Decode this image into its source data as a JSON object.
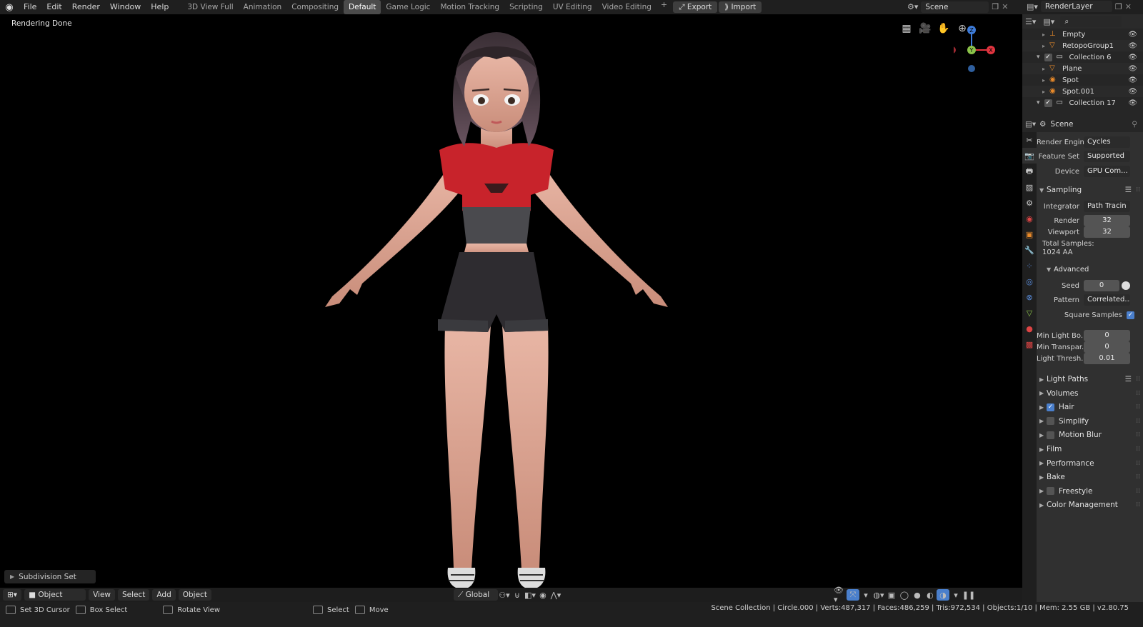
{
  "topbar": {
    "menu": [
      "File",
      "Edit",
      "Render",
      "Window",
      "Help"
    ],
    "workspaces": [
      "3D View Full",
      "Animation",
      "Compositing",
      "Default",
      "Game Logic",
      "Motion Tracking",
      "Scripting",
      "UV Editing",
      "Video Editing"
    ],
    "active_workspace": "Default",
    "export_label": "Export",
    "import_label": "Import",
    "scene": "Scene",
    "view_layer": "RenderLayer"
  },
  "viewport": {
    "status_text": "Rendering Done",
    "last_operator": "Subdivision Set",
    "gizmo_axes": [
      "Z",
      "Y",
      "X"
    ]
  },
  "viewport_header": {
    "mode": "Object Mode",
    "menus": [
      "View",
      "Select",
      "Add",
      "Object"
    ],
    "orientation": "Global"
  },
  "outliner": {
    "items": [
      {
        "name": "Empty",
        "indent": 2,
        "type": "empty"
      },
      {
        "name": "RetopoGroup1",
        "indent": 2,
        "type": "mesh"
      },
      {
        "name": "Collection 6",
        "indent": 1,
        "type": "collection"
      },
      {
        "name": "Plane",
        "indent": 2,
        "type": "mesh"
      },
      {
        "name": "Spot",
        "indent": 2,
        "type": "light"
      },
      {
        "name": "Spot.001",
        "indent": 2,
        "type": "light"
      },
      {
        "name": "Collection 17",
        "indent": 1,
        "type": "collection"
      }
    ]
  },
  "properties": {
    "context": "Scene",
    "render_engine_label": "Render Engine",
    "render_engine": "Cycles",
    "feature_set_label": "Feature Set",
    "feature_set": "Supported",
    "device_label": "Device",
    "device": "GPU Com...",
    "sampling_label": "Sampling",
    "integrator_label": "Integrator",
    "integrator": "Path Tracin",
    "render_label": "Render",
    "render_samples": "32",
    "viewport_label": "Viewport",
    "viewport_samples": "32",
    "total_samples_label": "Total Samples:",
    "total_samples": "1024 AA",
    "advanced_label": "Advanced",
    "seed_label": "Seed",
    "seed": "0",
    "pattern_label": "Pattern",
    "pattern": "Correlated...",
    "square_samples_label": "Square Samples",
    "min_light_bounces_label": "Min Light Bo...",
    "min_light_bounces": "0",
    "min_transparent_label": "Min Transpar...",
    "min_transparent": "0",
    "light_threshold_label": "Light Thresh...",
    "light_threshold": "0.01",
    "panels": [
      {
        "label": "Light Paths",
        "checkbox": null
      },
      {
        "label": "Volumes",
        "checkbox": null
      },
      {
        "label": "Hair",
        "checkbox": true
      },
      {
        "label": "Simplify",
        "checkbox": false
      },
      {
        "label": "Motion Blur",
        "checkbox": false
      },
      {
        "label": "Film",
        "checkbox": null
      },
      {
        "label": "Performance",
        "checkbox": null
      },
      {
        "label": "Bake",
        "checkbox": null
      },
      {
        "label": "Freestyle",
        "checkbox": false
      },
      {
        "label": "Color Management",
        "checkbox": null
      }
    ]
  },
  "statusbar": {
    "hints": [
      "Set 3D Cursor",
      "Box Select",
      "Rotate View",
      "Select",
      "Move"
    ],
    "stats": "Scene Collection | Circle.000 | Verts:487,317 | Faces:486,259 | Tris:972,534 | Objects:1/10 | Mem: 2.55 GB | v2.80.75"
  },
  "colors": {
    "accent": "#4a7fcc",
    "shirt": "#c8232b",
    "axis_x": "#e0343f",
    "axis_y": "#8bc34a",
    "axis_z": "#3d7bd8"
  }
}
